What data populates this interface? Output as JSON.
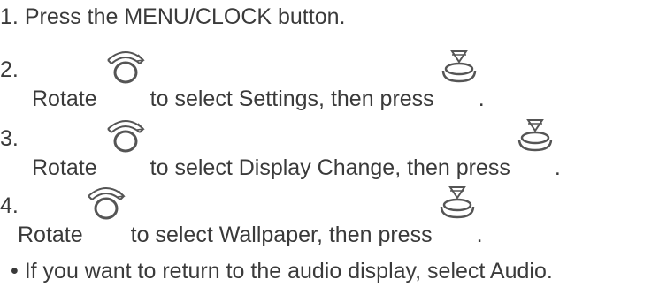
{
  "steps": [
    {
      "number": "1.",
      "text": "Press the MENU/CLOCK button."
    },
    {
      "number": "2.",
      "before": "Rotate",
      "middle": "to select Settings, then press",
      "end": "."
    },
    {
      "number": "3.",
      "before": "Rotate",
      "middle": "to select Display Change, then press",
      "end": "."
    },
    {
      "number": "4.",
      "before": "Rotate",
      "middle": "to select Wallpaper, then press",
      "end": "."
    }
  ],
  "note": "• If you want to return to the audio display, select Audio.",
  "icons": {
    "rotate": "rotate-knob-icon",
    "press": "press-knob-icon"
  },
  "colors": {
    "text": "#3a3a3a",
    "icon_stroke": "#555555"
  }
}
